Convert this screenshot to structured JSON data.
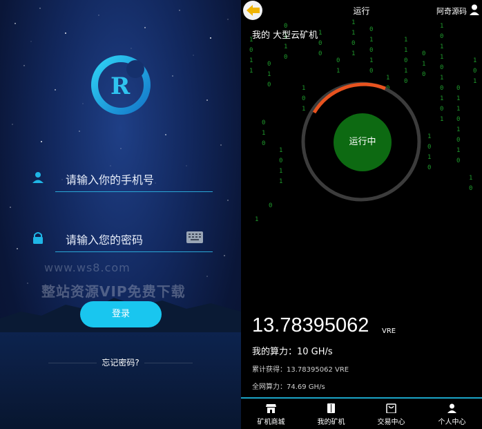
{
  "login": {
    "phone_placeholder": "请输入你的手机号",
    "password_placeholder": "请输入您的密码",
    "login_label": "登录",
    "forgot_label": "忘记密码?",
    "watermark_url": "www.ws8.com",
    "watermark_text": "整站资源VIP免费下载",
    "accent_color": "#19c6ef"
  },
  "miner": {
    "header_title": "运行",
    "brand": "阿奇源码",
    "miner_name": "我的 大型云矿机",
    "status": "运行中",
    "total_value": "13.78395062",
    "unit": "VRE",
    "my_power": "我的算力：10 GH/s",
    "cumulative": "累计获得：13.78395062 VRE",
    "network_power": "全网算力：74.69 GH/s",
    "ring_progress_color": "#e8531f",
    "status_color": "#0d6a12"
  },
  "tabs": [
    {
      "label": "矿机商城",
      "icon": "store-icon"
    },
    {
      "label": "我的矿机",
      "icon": "miner-icon"
    },
    {
      "label": "交易中心",
      "icon": "bag-icon"
    },
    {
      "label": "个人中心",
      "icon": "user-icon"
    }
  ]
}
